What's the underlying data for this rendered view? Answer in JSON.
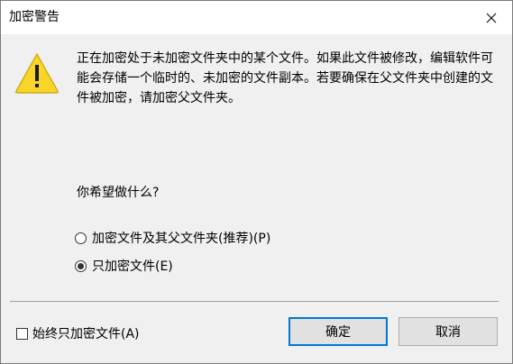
{
  "window": {
    "title": "加密警告",
    "close_icon": "close-icon"
  },
  "icons": {
    "warning": "warning-icon",
    "warning_color": "#f9d52a"
  },
  "message": "正在加密处于未加密文件夹中的某个文件。如果此文件被修改，编辑软件可能会存储一个临时的、未加密的文件副本。若要确保在父文件夹中创建的文件被加密，请加密父文件夹。",
  "question": "你希望做什么?",
  "options": [
    {
      "label": "加密文件及其父文件夹(推荐)(P)",
      "selected": false
    },
    {
      "label": "只加密文件(E)",
      "selected": true
    }
  ],
  "checkbox": {
    "label": "始终只加密文件(A)",
    "checked": false
  },
  "buttons": {
    "ok": "确定",
    "cancel": "取消"
  },
  "colors": {
    "accent": "#0078d7",
    "dialog_background": "#f0f0f0"
  }
}
